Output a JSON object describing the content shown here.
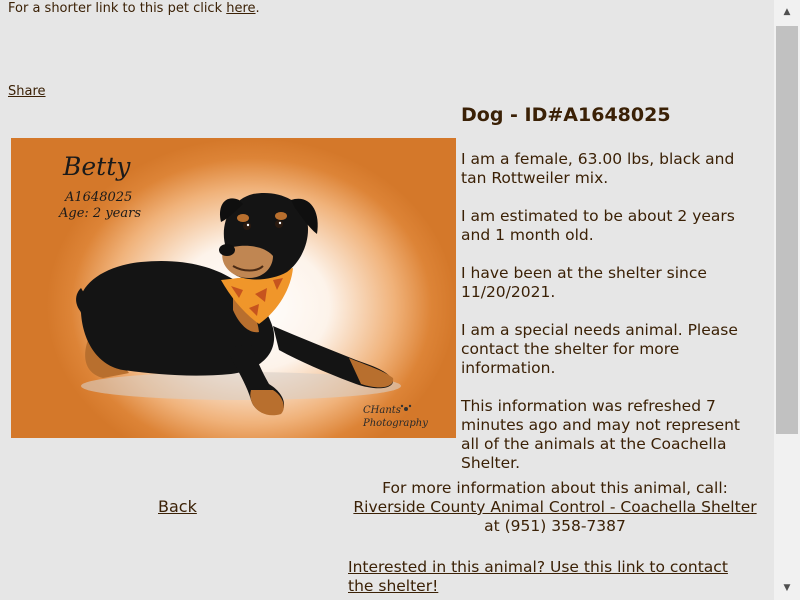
{
  "top_line": {
    "prefix": "For a shorter link to this pet click ",
    "link_label": "here",
    "suffix": "."
  },
  "share_label": "Share",
  "photo": {
    "name": "Betty",
    "id": "A1648025",
    "age": "Age: 2 years",
    "credit_line1": "CHants",
    "credit_line2": "Photography",
    "colors": {
      "background": "#d4782a",
      "dog_coat": "#141414",
      "dog_tan": "#b86f2e",
      "bandana": "#f0962a"
    }
  },
  "heading": "Dog - ID#A1648025",
  "info": {
    "p1": "I am a female, 63.00 lbs, black and tan Rottweiler mix.",
    "p2": "I am estimated to be about 2 years and 1 month old.",
    "p3": "I have been at the shelter since 11/20/2021.",
    "p4": "I am a special needs animal. Please contact the shelter for more information.",
    "p5": "This information was refreshed 7 minutes ago and may not represent all of the animals at the Coachella Shelter."
  },
  "back_label": "Back",
  "contact": {
    "intro": "For more information about this animal, call:",
    "org_link": "Riverside County Animal Control - Coachella Shelter",
    "phone_text": " at (951) 358-7387"
  },
  "interested_link": "Interested in this animal? Use this link to contact the shelter!",
  "colors": {
    "text": "#3b2106",
    "page_background": "#e6e6e6"
  }
}
